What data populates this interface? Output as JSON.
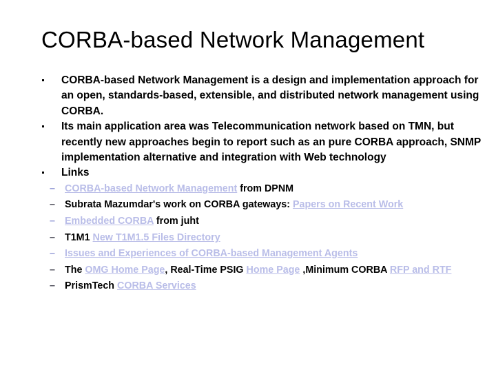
{
  "slide": {
    "title": "CORBA-based Network Management",
    "link_color": "#b9bde8",
    "text_color": "#000000",
    "background_color": "#ffffff",
    "bullets": [
      {
        "id": "bullet-1",
        "text": "CORBA-based Network Management is a design and implementation approach for an open, standards-based, extensible, and distributed network management using CORBA."
      },
      {
        "id": "bullet-2",
        "text": "Its main application area was Telecommunication network based on TMN, but recently new approaches begin to report such as an pure CORBA approach, SNMP implementation alternative and integration with Web technology"
      },
      {
        "id": "bullet-3",
        "text": "Links"
      }
    ],
    "links_sublist": [
      {
        "id": "sub-item-1",
        "marker": "–",
        "marker_style": "link",
        "parts": [
          {
            "kind": "link",
            "text": "CORBA-based Network Management"
          },
          {
            "kind": "plain",
            "text": " from DPNM"
          }
        ]
      },
      {
        "id": "sub-item-2",
        "marker": "–",
        "marker_style": "dark",
        "parts": [
          {
            "kind": "plain",
            "text": "Subrata Mazumdar's work on CORBA gateways: "
          },
          {
            "kind": "link",
            "text": "Papers on Recent Work"
          }
        ]
      },
      {
        "id": "sub-item-3",
        "marker": "–",
        "marker_style": "link",
        "parts": [
          {
            "kind": "link",
            "text": "Embedded CORBA"
          },
          {
            "kind": "plain",
            "text": " from juht"
          }
        ]
      },
      {
        "id": "sub-item-4",
        "marker": "–",
        "marker_style": "dark",
        "parts": [
          {
            "kind": "plain",
            "text": "T1M1 "
          },
          {
            "kind": "link",
            "text": "New T1M1.5 Files Directory"
          }
        ]
      },
      {
        "id": "sub-item-5",
        "marker": "–",
        "marker_style": "link",
        "parts": [
          {
            "kind": "link",
            "text": "Issues and Experiences of CORBA-based Management Agents"
          }
        ]
      },
      {
        "id": "sub-item-6",
        "marker": "–",
        "marker_style": "dark",
        "parts": [
          {
            "kind": "plain",
            "text": "The  "
          },
          {
            "kind": "link",
            "text": "OMG Home Page"
          },
          {
            "kind": "plain",
            "text": ",  Real-Time PSIG "
          },
          {
            "kind": "link",
            "text": "Home Page"
          },
          {
            "kind": "plain",
            "text": " ,Minimum CORBA "
          },
          {
            "kind": "link",
            "text": "RFP and RTF"
          }
        ]
      },
      {
        "id": "sub-item-7",
        "marker": "–",
        "marker_style": "dark",
        "parts": [
          {
            "kind": "plain",
            "text": "PrismTech "
          },
          {
            "kind": "link",
            "text": "CORBA Services"
          }
        ]
      }
    ]
  }
}
